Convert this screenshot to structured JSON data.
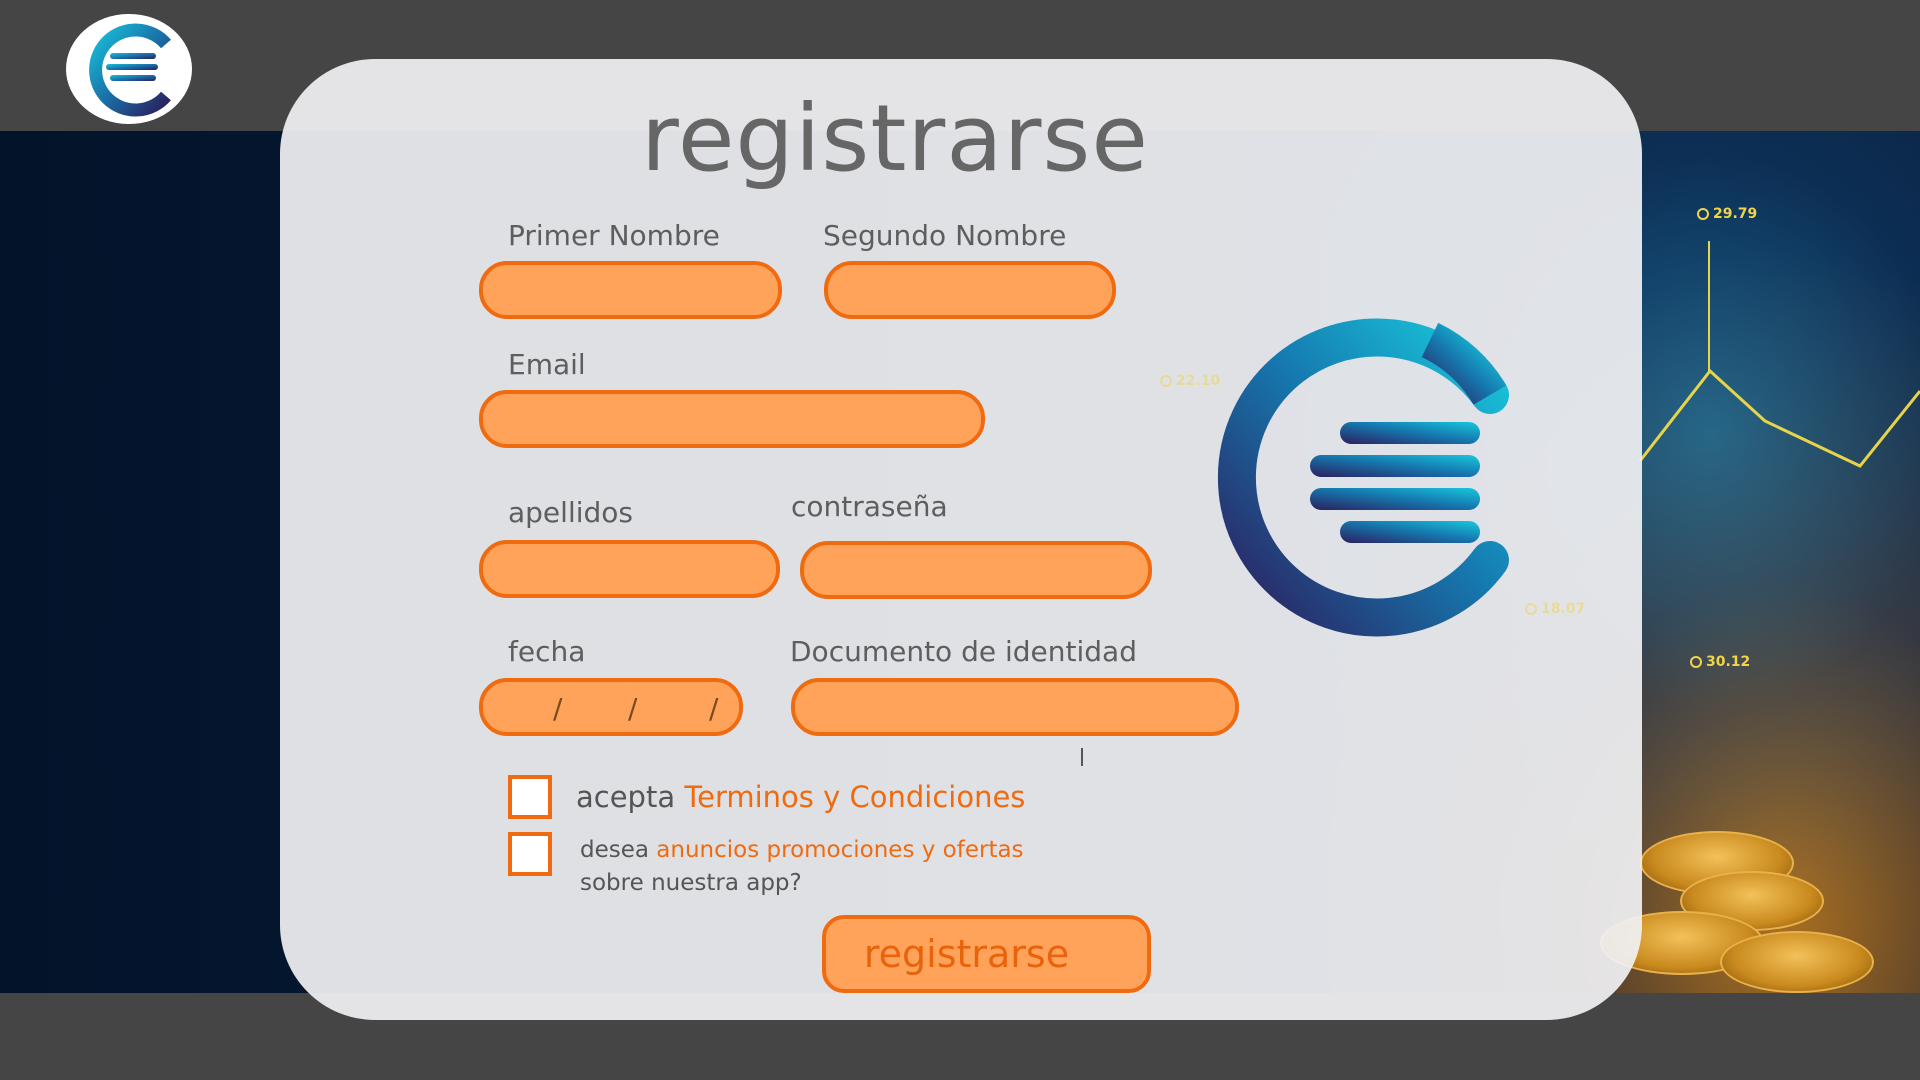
{
  "page": {
    "title": "registrarse",
    "colors": {
      "accent": "#f06b10",
      "field_fill": "#ffa35a",
      "title": "#666666",
      "header_bar": "#454545"
    }
  },
  "header": {
    "logo_icon": "brand-logo-icon"
  },
  "background": {
    "price_tags": [
      "29.79",
      "22.10",
      "18.07",
      "30.12"
    ]
  },
  "form": {
    "first_name": {
      "label": "Primer Nombre",
      "value": ""
    },
    "second_name": {
      "label": "Segundo Nombre",
      "value": ""
    },
    "email": {
      "label": "Email",
      "value": ""
    },
    "last_name": {
      "label": "apellidos",
      "value": ""
    },
    "password": {
      "label": "contraseña",
      "value": ""
    },
    "date": {
      "label": "fecha",
      "sep1": "/",
      "sep2": "/",
      "sep3": "/"
    },
    "id_document": {
      "label": "Documento de identidad",
      "value": ""
    },
    "terms": {
      "prefix": "acepta",
      "link": "Terminos y Condiciones",
      "checked": false
    },
    "promos": {
      "prefix": "desea",
      "link": "anuncios promociones y ofertas",
      "line2": "sobre nuestra app?",
      "checked": false
    },
    "submit_label": "registrarse"
  }
}
